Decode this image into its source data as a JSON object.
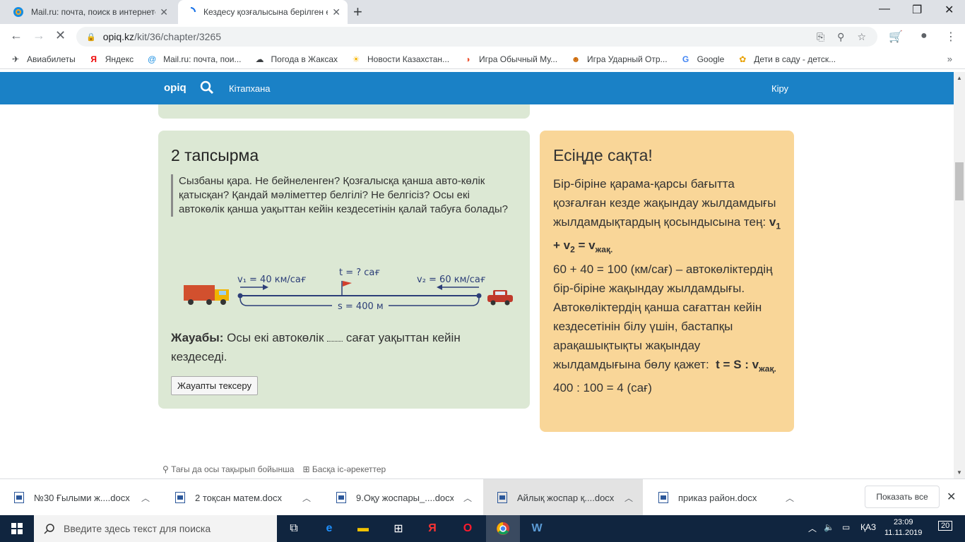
{
  "browser": {
    "tabs": [
      {
        "title": "Mail.ru: почта, поиск в интернете",
        "active": false
      },
      {
        "title": "Кездесу қозғалысына берілген есеп",
        "active": true
      }
    ],
    "url_host": "opiq.kz",
    "url_path": "/kit/36/chapter/3265"
  },
  "bookmarks": [
    {
      "label": "Авиабилеты",
      "icon": "plane-icon"
    },
    {
      "label": "Яндекс",
      "icon": "yandex-icon"
    },
    {
      "label": "Mail.ru: почта, пои...",
      "icon": "mailru-icon"
    },
    {
      "label": "Погода в Жаксах",
      "icon": "weather-icon"
    },
    {
      "label": "Новости Казахстан...",
      "icon": "sun-icon"
    },
    {
      "label": "Игра Обычный Му...",
      "icon": "game-icon"
    },
    {
      "label": "Игра Ударный Отр...",
      "icon": "game2-icon"
    },
    {
      "label": "Google",
      "icon": "google-icon"
    },
    {
      "label": "Дети в саду - детск...",
      "icon": "kids-icon"
    }
  ],
  "site": {
    "logo": "opiq",
    "library": "Кітапхана",
    "login": "Кіру"
  },
  "task": {
    "title": "2 тапсырма",
    "question": "Сызбаны қара. Не бейнеленген? Қозғалысқа қанша авто-көлік қатысқан? Қандай мәліметтер белгілі? Не белгісіз? Осы екі автокөлік қанша уақыттан кейін кездесетінін қалай табуға болады?",
    "diagram": {
      "v1": "v₁ = 40 км/сағ",
      "v2": "v₂ = 60 км/сағ",
      "t": "t = ? сағ",
      "s": "s = 400 м"
    },
    "answer_label": "Жауабы:",
    "answer_before": "Осы екі автокөлік",
    "answer_after": "сағат уақыттан кейін кездеседі.",
    "check_button": "Жауапты тексеру"
  },
  "remember": {
    "title": "Есіңде сақта!",
    "p1": "Бір-біріне қарама-қарсы бағытта қозғалған кезде жақындау жылдамдығы жылдамдықтардың қосындысына тең:",
    "formula1_a": "v",
    "formula1_a_sub": "1",
    "formula1_b": " + v",
    "formula1_b_sub": "2",
    "formula1_c": " = v",
    "formula1_c_sub": "жақ.",
    "p2": "60 + 40 = 100 (км/сағ) – автокөліктердің бір-біріне жақындау жылдамдығы.",
    "p3": "Автокөліктердің қанша сағаттан кейін кездесетінін білу үшін, бастапқы арақашықтықты жақындау жылдамдығына бөлу қажет:",
    "formula2": "t = S : v",
    "formula2_sub": "жақ.",
    "p4": "400 : 100 = 4 (сағ)"
  },
  "bottom_links": {
    "more_topic": "Тағы да осы тақырып бойынша",
    "other_actions": "Басқа іс-әрекеттер"
  },
  "downloads": [
    {
      "name": "№30  Ғылыми ж....docx"
    },
    {
      "name": "2 тоқсан матем.docx"
    },
    {
      "name": "9.Оқу жоспары_....docx"
    },
    {
      "name": "Айлық жоспар қ....docx"
    },
    {
      "name": "приказ район.docx"
    }
  ],
  "downloads_show_all": "Показать все",
  "taskbar": {
    "search_placeholder": "Введите здесь текст для поиска",
    "lang": "ҚАЗ",
    "time": "23:09",
    "date": "11.11.2019",
    "notif_count": "20"
  },
  "colors": {
    "site_blue": "#1a81c6",
    "task_green": "#dce8d4",
    "remember_orange": "#f9d698"
  }
}
